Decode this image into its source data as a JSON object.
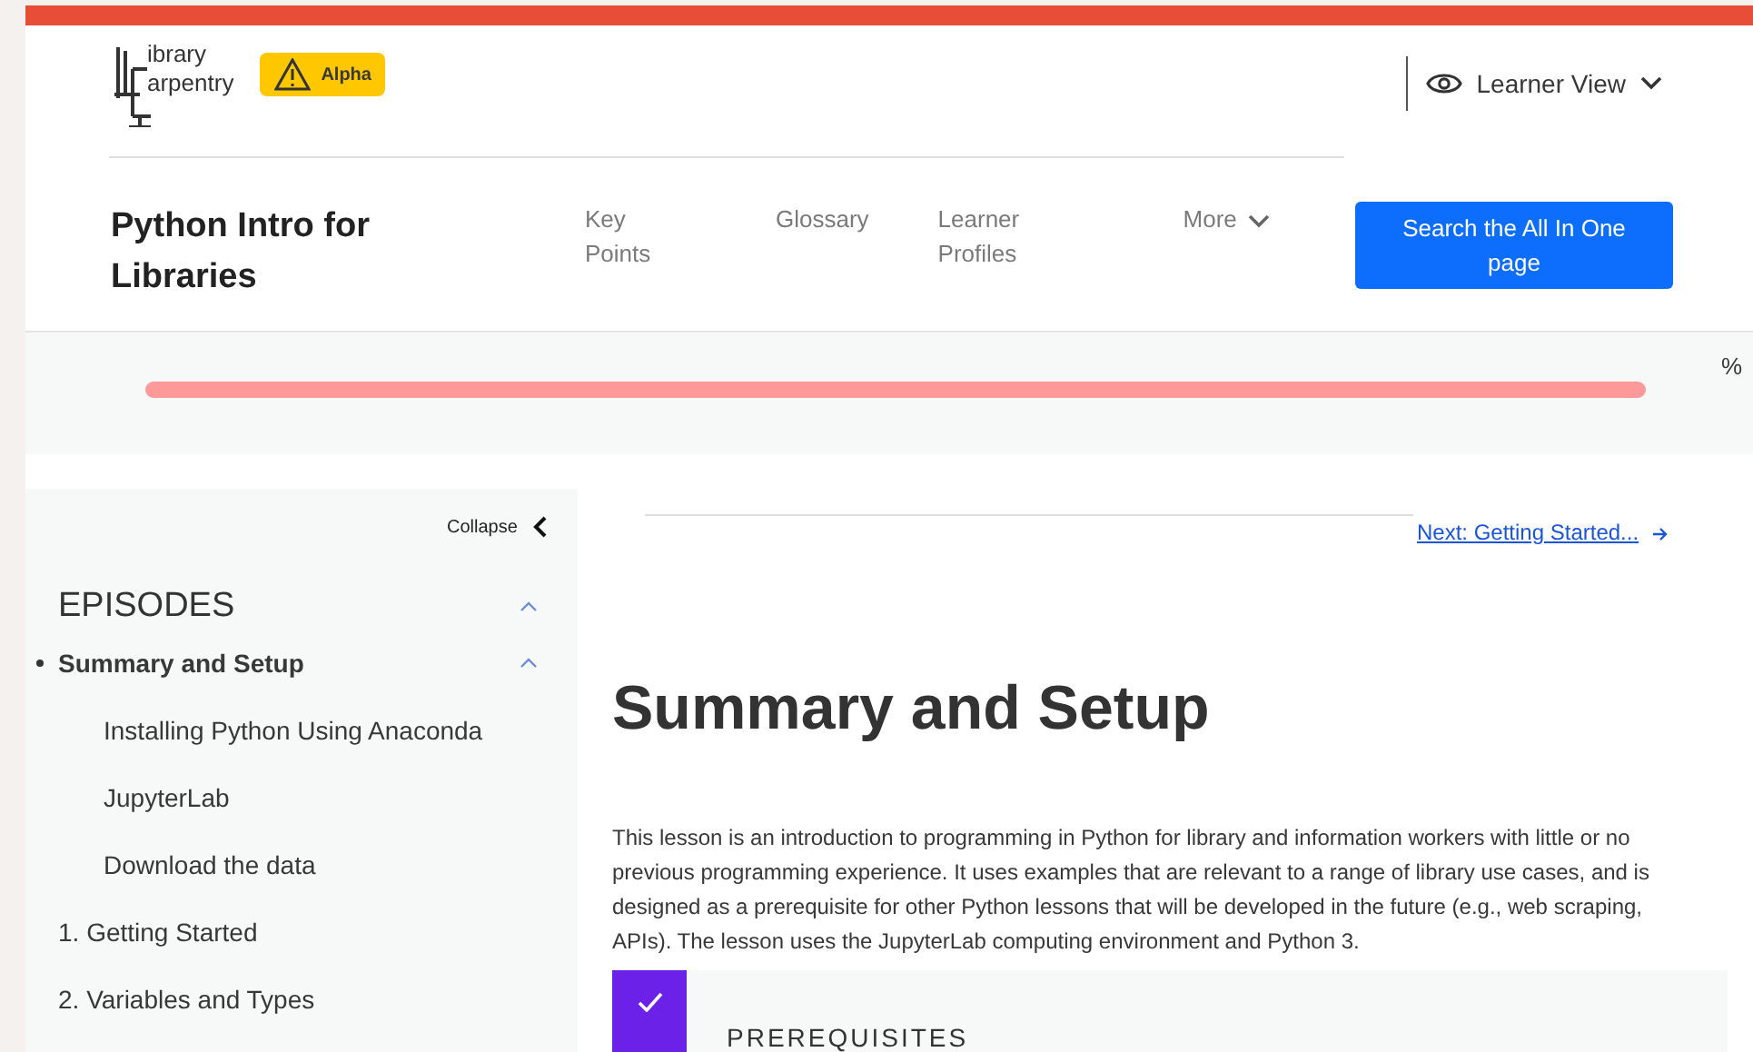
{
  "header": {
    "logo_lines": [
      "ibrary",
      "arpentry"
    ],
    "badge": "Alpha",
    "view_menu": "Learner View",
    "lesson_title": "Python Intro for Libraries",
    "nav": [
      {
        "label": "Key Points",
        "kind": "link"
      },
      {
        "label": "Glossary",
        "kind": "link"
      },
      {
        "label": "Learner Profiles",
        "kind": "link"
      },
      {
        "label": "More",
        "kind": "dropdown"
      }
    ],
    "search_button": "Search the All In One page"
  },
  "progress": {
    "reading": "%"
  },
  "sidebar": {
    "collapse": "Collapse",
    "heading": "EPISODES",
    "expanded": true,
    "items": [
      {
        "label": "Summary and Setup",
        "selected": true,
        "expanded": true,
        "children": [
          {
            "label": "Installing Python Using Anaconda"
          },
          {
            "label": "JupyterLab"
          },
          {
            "label": "Download the data"
          }
        ]
      },
      {
        "label": "1. Getting Started",
        "selected": false
      },
      {
        "label": "2. Variables and Types",
        "selected": false
      }
    ]
  },
  "main": {
    "next_link": "Next: Getting Started...",
    "title": "Summary and Setup",
    "intro": "This lesson is an introduction to programming in Python for library and information workers with little or no previous programming experience. It uses examples that are relevant to a range of library use cases, and is designed as a prerequisite for other Python lessons that will be developed in the future (e.g., web scraping, APIs). The lesson uses the JupyterLab computing environment and Python 3.",
    "callout": {
      "title": "PREREQUISITES"
    }
  }
}
